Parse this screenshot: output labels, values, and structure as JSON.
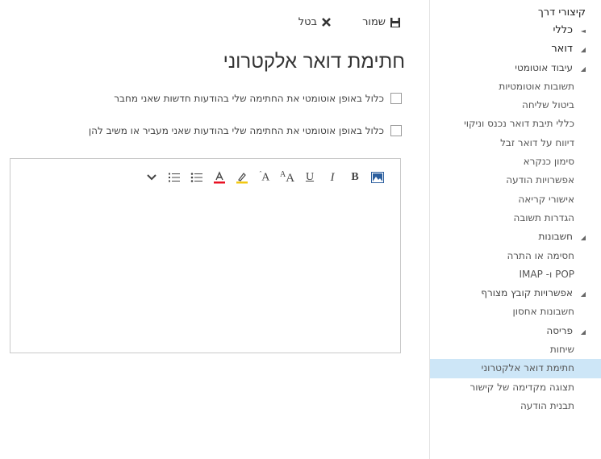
{
  "sidebar": {
    "title": "קיצורי דרך",
    "items": [
      {
        "label": "כללי",
        "kind": "top",
        "arrow": "◄"
      },
      {
        "label": "דואר",
        "kind": "top",
        "arrow": "◢"
      },
      {
        "label": "עיבוד אוטומטי",
        "kind": "group",
        "arrow": "◢"
      },
      {
        "label": "תשובות אוטומטיות",
        "kind": "sub"
      },
      {
        "label": "ביטול שליחה",
        "kind": "sub"
      },
      {
        "label": "כללי תיבת דואר נכנס וניקוי",
        "kind": "sub"
      },
      {
        "label": "דיווח על דואר זבל",
        "kind": "sub"
      },
      {
        "label": "סימון כנקרא",
        "kind": "sub"
      },
      {
        "label": "אפשרויות הודעה",
        "kind": "sub"
      },
      {
        "label": "אישורי קריאה",
        "kind": "sub"
      },
      {
        "label": "הגדרות תשובה",
        "kind": "sub"
      },
      {
        "label": "חשבונות",
        "kind": "group",
        "arrow": "◢"
      },
      {
        "label": "חסימה או התרה",
        "kind": "sub"
      },
      {
        "label": "POP ו- IMAP",
        "kind": "sub"
      },
      {
        "label": "אפשרויות קובץ מצורף",
        "kind": "group",
        "arrow": "◢"
      },
      {
        "label": "חשבונות אחסון",
        "kind": "sub"
      },
      {
        "label": "פריסה",
        "kind": "group",
        "arrow": "◢"
      },
      {
        "label": "שיחות",
        "kind": "sub"
      },
      {
        "label": "חתימת דואר אלקטרוני",
        "kind": "sub",
        "selected": true
      },
      {
        "label": "תצוגה מקדימה של קישור",
        "kind": "sub"
      },
      {
        "label": "תבנית הודעה",
        "kind": "sub"
      }
    ]
  },
  "commands": {
    "save_label": "שמור",
    "cancel_label": "בטל"
  },
  "page": {
    "title": "חתימת דואר אלקטרוני"
  },
  "options": {
    "new_messages": "כלול באופן אוטומטי את החתימה שלי בהודעות חדשות שאני מחבר",
    "forward_reply": "כלול באופן אוטומטי את החתימה שלי בהודעות שאני מעביר או משיב להן"
  },
  "editor": {
    "toolbar": [
      "insert-picture-icon",
      "bold-icon",
      "italic-icon",
      "underline-icon",
      "font-size-icon",
      "grow-font-icon",
      "highlight-icon",
      "font-color-icon",
      "bullets-icon",
      "numbering-icon",
      "more-options-icon"
    ],
    "accent_highlight": "#f2c811",
    "accent_fontcolor": "#e81123",
    "accent_picture": "#2c5f9e"
  }
}
